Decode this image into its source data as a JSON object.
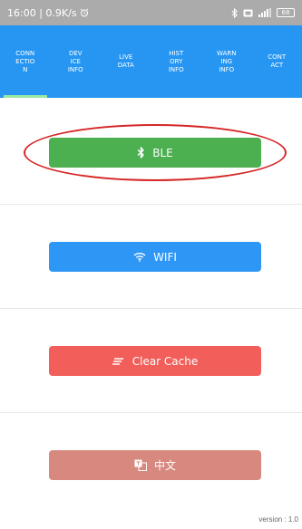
{
  "status_bar": {
    "time_speed": "16:00 | 0.9K/s",
    "alarm_icon": "alarm-clock-icon",
    "right_icons": [
      "bluetooth-icon",
      "battery-saver-icon",
      "signal-icon"
    ],
    "battery": "68"
  },
  "tabs": [
    {
      "label": "CONN\nECTIO\nN",
      "active": true
    },
    {
      "label": "DEV\nICE\nINFO",
      "active": false
    },
    {
      "label": "LIVE\nDATA",
      "active": false
    },
    {
      "label": "HIST\nORY\nINFO",
      "active": false
    },
    {
      "label": "WARN\nING\nINFO",
      "active": false
    },
    {
      "label": "CONT\nACT",
      "active": false
    }
  ],
  "buttons": {
    "ble": {
      "label": "BLE",
      "icon": "bluetooth-icon",
      "color": "#4caf50"
    },
    "wifi": {
      "label": "WIFI",
      "icon": "wifi-icon",
      "color": "#2e96f5"
    },
    "clear_cache": {
      "label": "Clear Cache",
      "icon": "clear-list-icon",
      "color": "#f25f5a"
    },
    "language": {
      "label": "中文",
      "icon": "translate-icon",
      "color": "#d8897f"
    }
  },
  "annotation": {
    "shape": "red-ellipse",
    "target": "ble-button",
    "color": "#d62626"
  },
  "footer": {
    "version": "version : 1.0"
  },
  "colors": {
    "tab_bar": "#2696f2",
    "tab_indicator": "#9be8a3",
    "status_bar": "#ababab"
  }
}
